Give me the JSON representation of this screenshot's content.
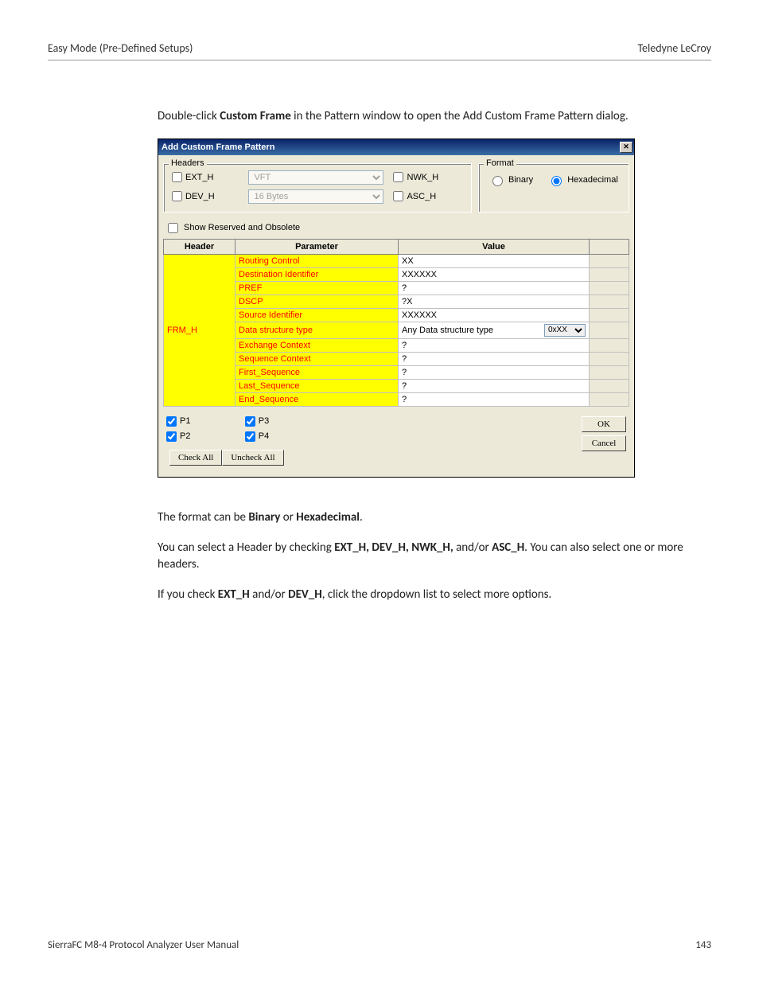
{
  "headerLeft": "Easy Mode (Pre-Defined Setups)",
  "headerRight": "Teledyne  LeCroy",
  "intro": {
    "pre": "Double-click ",
    "bold": "Custom Frame",
    "post": " in the Pattern window to open the Add Custom Frame Pattern dialog."
  },
  "dialog": {
    "title": "Add Custom Frame Pattern",
    "headersLegend": "Headers",
    "formatLegend": "Format",
    "ext_h": "EXT_H",
    "dev_h": "DEV_H",
    "nwk_h": "NWK_H",
    "asc_h": "ASC_H",
    "extCombo": "VFT",
    "devCombo": "16 Bytes",
    "binary": "Binary",
    "hex": "Hexadecimal",
    "reserved": "Show Reserved and Obsolete",
    "thHeader": "Header",
    "thParam": "Parameter",
    "thValue": "Value",
    "rows": [
      {
        "param": "Routing Control",
        "value": "XX"
      },
      {
        "param": "Destination Identifier",
        "value": "XXXXXX"
      },
      {
        "param": "PREF",
        "value": "?"
      },
      {
        "param": "DSCP",
        "value": "?X"
      },
      {
        "param": "Source Identifier",
        "value": "XXXXXX"
      },
      {
        "param": "Data structure type",
        "value": "Any Data structure type",
        "combo": "0xXX"
      },
      {
        "param": "Exchange Context",
        "value": "?"
      },
      {
        "param": "Sequence Context",
        "value": "?"
      },
      {
        "param": "First_Sequence",
        "value": "?"
      },
      {
        "param": "Last_Sequence",
        "value": "?"
      },
      {
        "param": "End_Sequence",
        "value": "?"
      }
    ],
    "headerCell": "FRM_H",
    "ports": {
      "p1": "P1",
      "p2": "P2",
      "p3": "P3",
      "p4": "P4"
    },
    "ok": "OK",
    "cancel": "Cancel",
    "checkAll": "Check All",
    "uncheckAll": "Uncheck All"
  },
  "afterText": {
    "p1_pre": "The format can be ",
    "p1_b1": "Binary",
    "p1_mid": " or ",
    "p1_b2": "Hexadecimal",
    "p1_post": ".",
    "p2_pre": "You can select a Header by checking ",
    "p2_b": "EXT_H, DEV_H, NWK_H,",
    "p2_mid": " and/or ",
    "p2_b2": "ASC_H",
    "p2_post": ". You can also select one or more headers.",
    "p3_pre": "If you check ",
    "p3_b1": "EXT_H",
    "p3_mid": " and/or ",
    "p3_b2": "DEV_H",
    "p3_post": ", click the dropdown list to select more options."
  },
  "footerLeft": "SierraFC M8-4 Protocol Analyzer User Manual",
  "footerRight": "143"
}
